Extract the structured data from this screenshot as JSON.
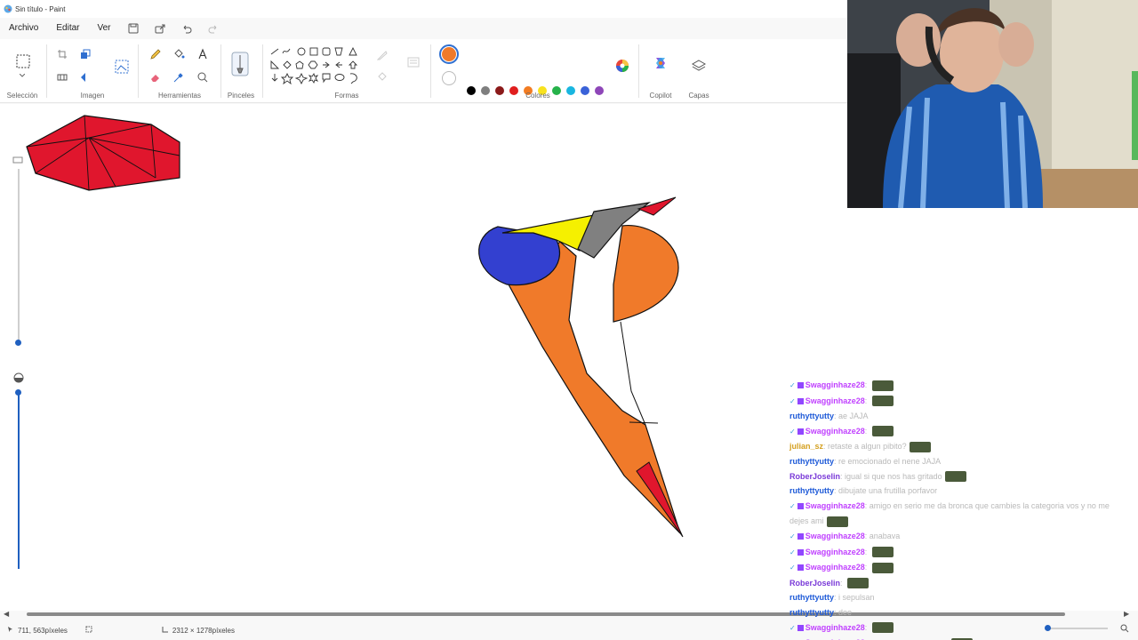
{
  "window": {
    "title": "Sin título - Paint"
  },
  "menu": {
    "file": "Archivo",
    "edit": "Editar",
    "view": "Ver"
  },
  "ribbon": {
    "groups": {
      "selection": "Selección",
      "image": "Imagen",
      "tools": "Herramientas",
      "brushes": "Pinceles",
      "shapes": "Formas",
      "colors": "Colores",
      "copilot": "Copilot",
      "layers": "Capas"
    },
    "active_color": "#f07a2a",
    "palette_row1": [
      "#000000",
      "#7f7f7f",
      "#8b1a1a",
      "#e01e1e",
      "#f27c22",
      "#f8e21e",
      "#26b24a",
      "#19b6e0",
      "#3a62d8",
      "#8e46b8"
    ],
    "palette_row2": [
      "#ffffff",
      "#c3c3c3",
      "#b97a57",
      "#f5a7c4",
      "#f7c72a",
      "#eee8a0",
      "#b5e61d",
      "#99d9ea",
      "#7092be",
      "#c8bfe7"
    ]
  },
  "status": {
    "cursor_position": "711, 563píxeles",
    "canvas_size": "2312 × 1278píxeles"
  },
  "chat": [
    {
      "user": "Swagginhaze28",
      "color": "#c040ff",
      "badge": true,
      "message": "",
      "emote": true
    },
    {
      "user": "Swagginhaze28",
      "color": "#c040ff",
      "badge": true,
      "message": "",
      "emote": true
    },
    {
      "user": "ruthyttyutty",
      "color": "#1e5ad8",
      "badge": false,
      "message": "ae JAJA",
      "emote": false
    },
    {
      "user": "Swagginhaze28",
      "color": "#c040ff",
      "badge": true,
      "message": "",
      "emote": true
    },
    {
      "user": "julian_sz",
      "color": "#d4a020",
      "badge": false,
      "message": "retaste a algun pibito?",
      "emote": true
    },
    {
      "user": "ruthyttyutty",
      "color": "#1e5ad8",
      "badge": false,
      "message": "re emocionado el nene JAJA",
      "emote": false
    },
    {
      "user": "RoberJoselin",
      "color": "#7a3ad8",
      "badge": false,
      "message": "igual si que nos has gritado",
      "emote": true
    },
    {
      "user": "ruthyttyutty",
      "color": "#1e5ad8",
      "badge": false,
      "message": "dibujate una frutilla porfavor",
      "emote": false
    },
    {
      "user": "Swagginhaze28",
      "color": "#c040ff",
      "badge": true,
      "message": "amigo en serio me da bronca que cambies la categoria vos y no me",
      "emote": false
    },
    {
      "user": "",
      "color": "#b9b9b9",
      "badge": false,
      "message": "dejes ami",
      "emote": true
    },
    {
      "user": "Swagginhaze28",
      "color": "#c040ff",
      "badge": true,
      "message": "anabava",
      "emote": false
    },
    {
      "user": "Swagginhaze28",
      "color": "#c040ff",
      "badge": true,
      "message": "",
      "emote": true
    },
    {
      "user": "Swagginhaze28",
      "color": "#c040ff",
      "badge": true,
      "message": "",
      "emote": true
    },
    {
      "user": "RoberJoselin",
      "color": "#7a3ad8",
      "badge": false,
      "message": "",
      "emote": true
    },
    {
      "user": "ruthyttyutty",
      "color": "#1e5ad8",
      "badge": false,
      "message": "i sepulsan",
      "emote": false
    },
    {
      "user": "ruthyttyutty",
      "color": "#1e5ad8",
      "badge": false,
      "message": "dee",
      "emote": false
    },
    {
      "user": "Swagginhaze28",
      "color": "#c040ff",
      "badge": true,
      "message": "",
      "emote": true
    },
    {
      "user": "Swagginhaze28",
      "color": "#c040ff",
      "badge": true,
      "message": "mmm me voy a comer",
      "emote": true
    }
  ]
}
